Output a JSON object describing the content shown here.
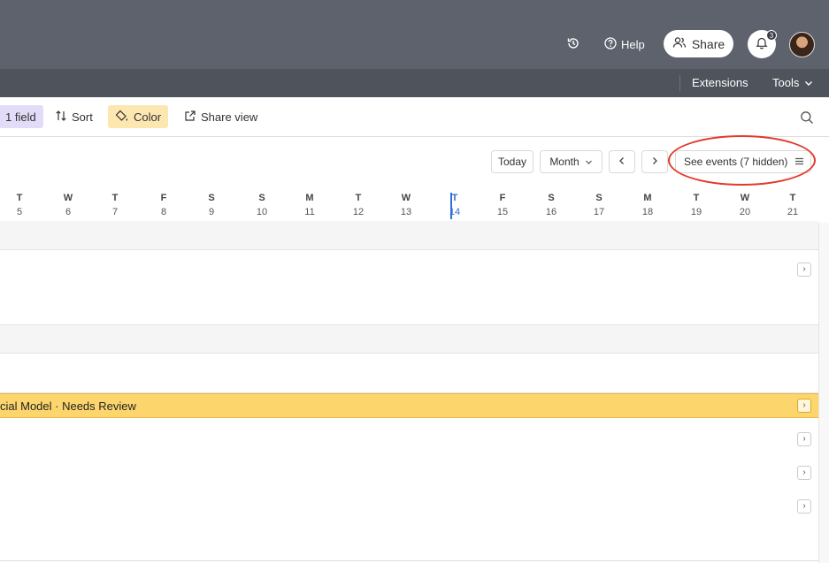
{
  "topbar": {
    "help_label": "Help",
    "share_label": "Share",
    "notification_count": "3",
    "icons": [
      "history-icon",
      "help-circle-icon",
      "users-icon",
      "bell-icon"
    ]
  },
  "subbar": {
    "extensions_label": "Extensions",
    "tools_label": "Tools"
  },
  "toolbar": {
    "field_label": "1 field",
    "sort_label": "Sort",
    "color_label": "Color",
    "share_view_label": "Share view"
  },
  "calendar": {
    "today_label": "Today",
    "view_label": "Month",
    "see_events_label": "See events (7 hidden)",
    "days": [
      {
        "letter": "T",
        "num": "5"
      },
      {
        "letter": "W",
        "num": "6"
      },
      {
        "letter": "T",
        "num": "7"
      },
      {
        "letter": "F",
        "num": "8"
      },
      {
        "letter": "S",
        "num": "9"
      },
      {
        "letter": "S",
        "num": "10"
      },
      {
        "letter": "M",
        "num": "11"
      },
      {
        "letter": "T",
        "num": "12"
      },
      {
        "letter": "W",
        "num": "13"
      },
      {
        "letter": "T",
        "num": "14"
      },
      {
        "letter": "F",
        "num": "15"
      },
      {
        "letter": "S",
        "num": "16"
      },
      {
        "letter": "S",
        "num": "17"
      },
      {
        "letter": "M",
        "num": "18"
      },
      {
        "letter": "T",
        "num": "19"
      },
      {
        "letter": "W",
        "num": "20"
      },
      {
        "letter": "T",
        "num": "21"
      }
    ],
    "today_day": "14",
    "event_text": "cial Model · Needs Review"
  },
  "colors": {
    "topbar": "#5d626c",
    "event": "#fcd66d",
    "today": "#2f6fd6",
    "highlight_oval": "#e23a2c"
  }
}
